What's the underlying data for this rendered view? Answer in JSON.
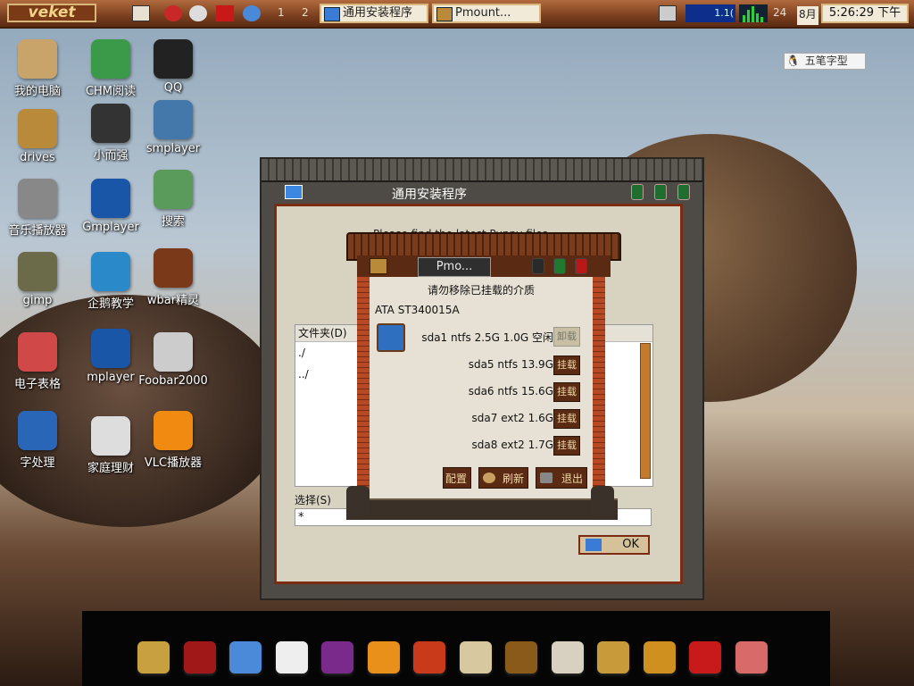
{
  "taskbar": {
    "menu_label": "veket",
    "desk1": "1",
    "desk2": "2",
    "task1": "通用安装程序",
    "task2": "Pmount...",
    "net_rate": "1.1(",
    "cpu_badge": "24",
    "month_badge": "8月",
    "clock": "5:26:29 下午"
  },
  "ime": {
    "label": "五笔字型"
  },
  "desktop_icons": [
    {
      "label": "我的电脑",
      "icon": "home-icon",
      "color": "#c9a46a"
    },
    {
      "label": "CHM阅读",
      "icon": "book-icon",
      "color": "#3b9a4a"
    },
    {
      "label": "QQ",
      "icon": "penguin-icon",
      "color": "#222222"
    },
    {
      "label": "drives",
      "icon": "drive-icon",
      "color": "#b88a3a"
    },
    {
      "label": "小而强",
      "icon": "usb-icon",
      "color": "#333333"
    },
    {
      "label": "smplayer",
      "icon": "film-reel-icon",
      "color": "#4477aa"
    },
    {
      "label": "音乐播放器",
      "icon": "speaker-icon",
      "color": "#888888"
    },
    {
      "label": "Gmplayer",
      "icon": "clapper-icon",
      "color": "#1a56a8"
    },
    {
      "label": "搜索",
      "icon": "search-icon",
      "color": "#5a9a5a"
    },
    {
      "label": "gimp",
      "icon": "gimp-icon",
      "color": "#6b6b4a"
    },
    {
      "label": "企鹅教学",
      "icon": "penguin-headphones-icon",
      "color": "#2a8ac9"
    },
    {
      "label": "wbar精灵",
      "icon": "app-icon",
      "color": "#7a3a1a"
    },
    {
      "label": "电子表格",
      "icon": "spreadsheet-icon",
      "color": "#d04848"
    },
    {
      "label": "mplayer",
      "icon": "clapper-icon",
      "color": "#1a56a8"
    },
    {
      "label": "Foobar2000",
      "icon": "speakers-icon",
      "color": "#cccccc"
    },
    {
      "label": "字处理",
      "icon": "pen-icon",
      "color": "#2a66b8"
    },
    {
      "label": "家庭理财",
      "icon": "calculator-icon",
      "color": "#dddddd"
    },
    {
      "label": "VLC播放器",
      "icon": "vlc-cone-icon",
      "color": "#f08a10"
    }
  ],
  "installer": {
    "title": "通用安装程序",
    "instruction": "Please find the latest Puppy files",
    "folder_header": "文件夹(D)",
    "folders": [
      "./",
      "../"
    ],
    "select_label": "选择(S)",
    "select_value": "*",
    "ok_label": "OK"
  },
  "pmount": {
    "title": "Pmo...",
    "instruction": "请勿移除已挂载的介质",
    "drive": "ATA ST340015A",
    "partitions": [
      {
        "info": "sda1 ntfs 2.5G 1.0G 空闲",
        "action": "卸载"
      },
      {
        "info": "sda5 ntfs 13.9G",
        "action": "挂载"
      },
      {
        "info": "sda6 ntfs 15.6G",
        "action": "挂载"
      },
      {
        "info": "sda7 ext2 1.6G",
        "action": "挂载"
      },
      {
        "info": "sda8 ext2 1.7G",
        "action": "挂载"
      }
    ],
    "btn_config": "配置",
    "btn_refresh": "刷新",
    "btn_quit": "退出"
  },
  "dock_icons": [
    {
      "name": "pagoda-icon",
      "color": "#c9a040"
    },
    {
      "name": "red-book-icon",
      "color": "#a01818"
    },
    {
      "name": "globe-icon",
      "color": "#4a8ad8"
    },
    {
      "name": "papers-icon",
      "color": "#eeeeee"
    },
    {
      "name": "purple-app-icon",
      "color": "#7a2a8a"
    },
    {
      "name": "palette-icon",
      "color": "#e8901a"
    },
    {
      "name": "lantern-icon",
      "color": "#c83a1a"
    },
    {
      "name": "scroll-icon",
      "color": "#d8c8a0"
    },
    {
      "name": "abacus-icon",
      "color": "#8a5a1a"
    },
    {
      "name": "painting-icon",
      "color": "#d8d0c0"
    },
    {
      "name": "box-icon",
      "color": "#c89a3a"
    },
    {
      "name": "taiji-icon",
      "color": "#d09020"
    },
    {
      "name": "fu-charm-icon",
      "color": "#c81a1a"
    },
    {
      "name": "ink-brush-icon",
      "color": "#d86a6a"
    }
  ]
}
